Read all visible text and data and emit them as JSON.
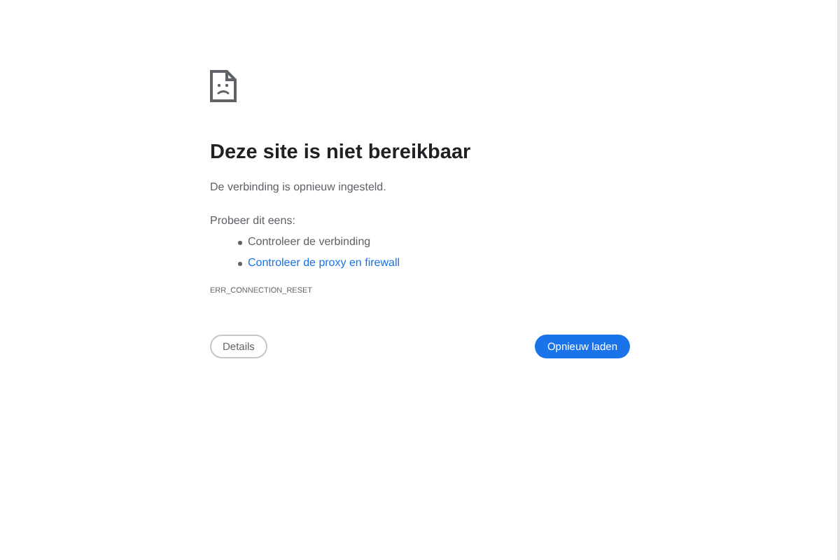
{
  "heading": "Deze site is niet bereikbaar",
  "message": "De verbinding is opnieuw ingesteld.",
  "suggestions_intro": "Probeer dit eens:",
  "suggestions": [
    {
      "kind": "text",
      "label": "Controleer de verbinding"
    },
    {
      "kind": "link",
      "label": "Controleer de proxy en firewall"
    }
  ],
  "error_code": "ERR_CONNECTION_RESET",
  "buttons": {
    "details": "Details",
    "reload": "Opnieuw laden"
  }
}
